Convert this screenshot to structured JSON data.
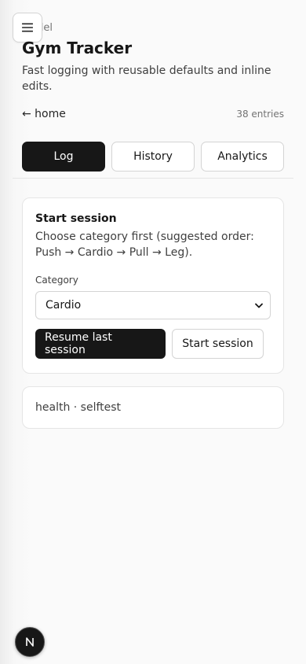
{
  "header": {
    "eyebrow": "Model",
    "title": "Gym Tracker",
    "subtitle": "Fast logging with reusable defaults and inline edits.",
    "home_link": "← home",
    "entries": "38 entries"
  },
  "tabs": [
    {
      "label": "Log",
      "active": true
    },
    {
      "label": "History",
      "active": false
    },
    {
      "label": "Analytics",
      "active": false
    }
  ],
  "session": {
    "title": "Start session",
    "description": "Choose category first (suggested order: Push → Cardio → Pull → Leg).",
    "category_label": "Category",
    "category_value": "Cardio",
    "resume_button": "Resume last session",
    "start_button": "Start session"
  },
  "health": {
    "text": "health · selftest"
  },
  "icons": {
    "menu": "hamburger-menu-icon",
    "select": "chevron-down-icon",
    "badge": "next-logo-icon"
  },
  "colors": {
    "primary": "#171717",
    "border": "#d4d4d4",
    "background": "#fafafa"
  }
}
